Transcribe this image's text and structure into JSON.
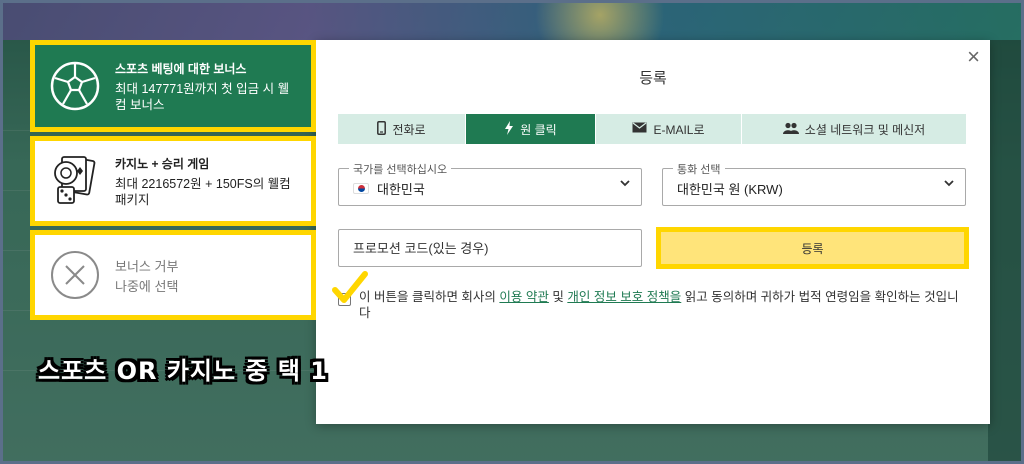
{
  "bonus": {
    "sports": {
      "title": "스포츠 베팅에 대한 보너스",
      "desc": "최대 147771원까지 첫 입금 시 웰컴 보너스",
      "icon": "soccer-ball-icon"
    },
    "casino": {
      "title": "카지노 + 승리 게임",
      "desc": "최대 2216572원 + 150FS의 웰컴 패키지",
      "icon": "casino-cards-dice-icon"
    },
    "decline": {
      "title": "보너스 거부",
      "desc": "나중에 선택",
      "icon": "close-circle-icon"
    }
  },
  "caption": "스포츠 OR 카지노 중 택 1",
  "modal": {
    "title": "등록",
    "close_label": "×",
    "tabs": [
      {
        "label": "전화로",
        "icon": "phone-icon",
        "active": false
      },
      {
        "label": "원 클릭",
        "icon": "lightning-icon",
        "active": true
      },
      {
        "label": "E-MAIL로",
        "icon": "envelope-icon",
        "active": false
      },
      {
        "label": "소셜 네트워크 및 메신저",
        "icon": "people-icon",
        "active": false
      }
    ],
    "country": {
      "label": "국가를 선택하십시오",
      "value": "대한민국"
    },
    "currency": {
      "label": "통화 선택",
      "value": "대한민국 원 (KRW)"
    },
    "promo_placeholder": "프로모션 코드(있는 경우)",
    "register_label": "등록",
    "terms": {
      "before": "이 버튼을 클릭하면 회사의 ",
      "link1": "이용 약관",
      "mid": " 및 ",
      "link2": "개인 정보 보호 정책을",
      "after": " 읽고 동의하며 귀하가 법적 연령임을 확인하는 것입니다"
    }
  },
  "colors": {
    "brand_green": "#1f7a52",
    "highlight_yellow": "#ffd600",
    "tab_inactive": "#d6ece4"
  }
}
